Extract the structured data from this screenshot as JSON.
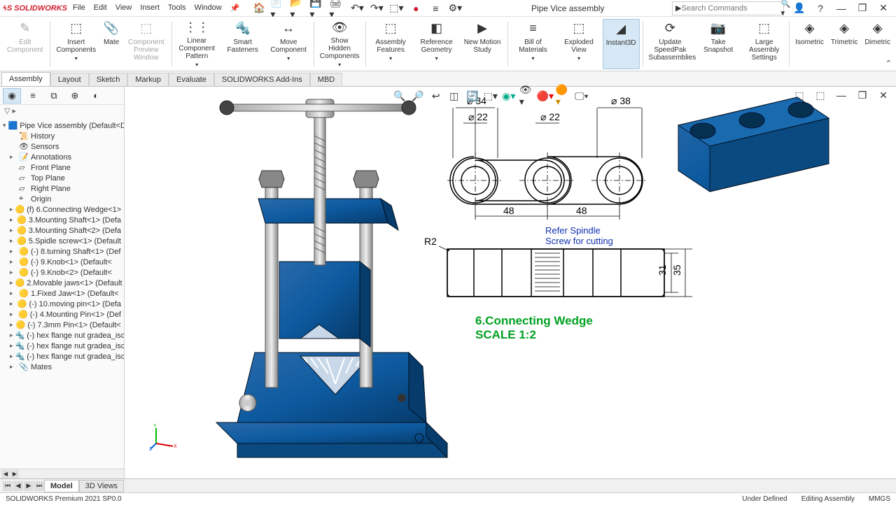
{
  "title": {
    "logo": "SOLIDWORKS",
    "doc": "Pipe Vice assembly"
  },
  "menu": [
    "File",
    "Edit",
    "View",
    "Insert",
    "Tools",
    "Window"
  ],
  "search": {
    "placeholder": "Search Commands"
  },
  "ribbon": [
    {
      "label": "Edit Component",
      "icon": "✎",
      "disabled": true
    },
    {
      "label": "Insert Components",
      "icon": "⬚",
      "dd": true
    },
    {
      "label": "Mate",
      "icon": "📎"
    },
    {
      "label": "Component Preview Window",
      "icon": "⬚",
      "disabled": true
    },
    {
      "label": "Linear Component Pattern",
      "icon": "⋮⋮",
      "dd": true
    },
    {
      "label": "Smart Fasteners",
      "icon": "🔩"
    },
    {
      "label": "Move Component",
      "icon": "↔",
      "dd": true
    },
    {
      "label": "Show Hidden Components",
      "icon": "👁",
      "dd": true
    },
    {
      "label": "Assembly Features",
      "icon": "⬚",
      "dd": true
    },
    {
      "label": "Reference Geometry",
      "icon": "◧",
      "dd": true
    },
    {
      "label": "New Motion Study",
      "icon": "▶"
    },
    {
      "label": "Bill of Materials",
      "icon": "≡",
      "dd": true
    },
    {
      "label": "Exploded View",
      "icon": "⬚",
      "dd": true
    },
    {
      "label": "Instant3D",
      "icon": "◢",
      "active": true
    },
    {
      "label": "Update SpeedPak Subassemblies",
      "icon": "⟳"
    },
    {
      "label": "Take Snapshot",
      "icon": "📷"
    },
    {
      "label": "Large Assembly Settings",
      "icon": "⬚"
    },
    {
      "label": "Isometric",
      "icon": "◈"
    },
    {
      "label": "Trimetric",
      "icon": "◈"
    },
    {
      "label": "Dimetric",
      "icon": "◈"
    }
  ],
  "tabs": [
    "Assembly",
    "Layout",
    "Sketch",
    "Markup",
    "Evaluate",
    "SOLIDWORKS Add-Ins",
    "MBD"
  ],
  "tree": {
    "root": "Pipe Vice assembly  (Default<D",
    "items": [
      {
        "icon": "📜",
        "label": "History"
      },
      {
        "icon": "👁",
        "label": "Sensors"
      },
      {
        "icon": "📝",
        "label": "Annotations",
        "exp": true
      },
      {
        "icon": "▱",
        "label": "Front Plane"
      },
      {
        "icon": "▱",
        "label": "Top Plane"
      },
      {
        "icon": "▱",
        "label": "Right Plane"
      },
      {
        "icon": "⌖",
        "label": "Origin"
      },
      {
        "icon": "🟡",
        "label": "(f) 6.Connecting Wedge<1>",
        "exp": true
      },
      {
        "icon": "🟡",
        "label": "3.Mounting Shaft<1>  (Defa",
        "exp": true
      },
      {
        "icon": "🟡",
        "label": "3.Mounting Shaft<2>  (Defa",
        "exp": true
      },
      {
        "icon": "🟡",
        "label": "5.Spidle screw<1>  (Default",
        "exp": true
      },
      {
        "icon": "🟡",
        "label": "(-) 8.turning Shaft<1>  (Def",
        "exp": true
      },
      {
        "icon": "🟡",
        "label": "(-) 9.Knob<1>  (Default<<D",
        "exp": true
      },
      {
        "icon": "🟡",
        "label": "(-) 9.Knob<2>  (Default<<D",
        "exp": true
      },
      {
        "icon": "🟡",
        "label": "2.Movable jaws<1>  (Default",
        "exp": true
      },
      {
        "icon": "🟡",
        "label": "1.Fixed Jaw<1>  (Default<<D",
        "exp": true
      },
      {
        "icon": "🟡",
        "label": "(-) 10.moving pin<1>  (Defa",
        "exp": true
      },
      {
        "icon": "🟡",
        "label": "(-) 4.Mounting Pin<1>  (Def",
        "exp": true
      },
      {
        "icon": "🟡",
        "label": "(-) 7.3mm Pin<1>  (Default<",
        "exp": true
      },
      {
        "icon": "🔩",
        "label": "(-) hex flange nut gradea_isc",
        "exp": true
      },
      {
        "icon": "🔩",
        "label": "(-) hex flange nut gradea_isc",
        "exp": true
      },
      {
        "icon": "🔩",
        "label": "(-) hex flange nut gradea_isc",
        "exp": true
      },
      {
        "icon": "📎",
        "label": "Mates",
        "exp": true
      }
    ]
  },
  "bottom_tabs": [
    "Model",
    "3D Views"
  ],
  "status": {
    "left": "SOLIDWORKS Premium 2021 SP0.0",
    "center": "Under Defined",
    "right1": "Editing Assembly",
    "right2": "MMGS"
  },
  "drawing": {
    "d34": "⌀ 34",
    "d38": "⌀ 38",
    "d22a": "⌀ 22",
    "d22b": "⌀ 22",
    "dim48a": "48",
    "dim48b": "48",
    "r2": "R2",
    "dim31": "31",
    "dim35": "35",
    "note1": "Refer Spindle",
    "note2": "Screw for cutting",
    "title1": "6.Connecting Wedge",
    "title2": "SCALE 1:2"
  }
}
